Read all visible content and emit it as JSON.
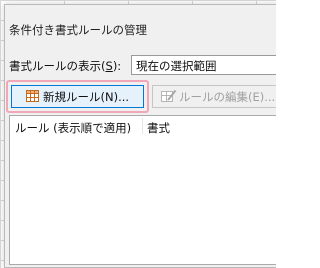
{
  "dialog": {
    "title": "条件付き書式ルールの管理"
  },
  "show_rules": {
    "label_prefix": "書式ルールの表示(",
    "label_accel": "S",
    "label_suffix": "):",
    "selected_value": "現在の選択範囲"
  },
  "toolbar": {
    "new_rule_label": "新規ルール(N)...",
    "edit_rule_label": "ルールの編集(E)...",
    "highlight_color": "#f2a7b9"
  },
  "rules_list": {
    "columns": [
      "ルール (表示順で適用)",
      "書式"
    ]
  },
  "icons": {
    "new_rule": "new-rule-grid-icon",
    "edit_rule": "edit-rule-icon"
  }
}
